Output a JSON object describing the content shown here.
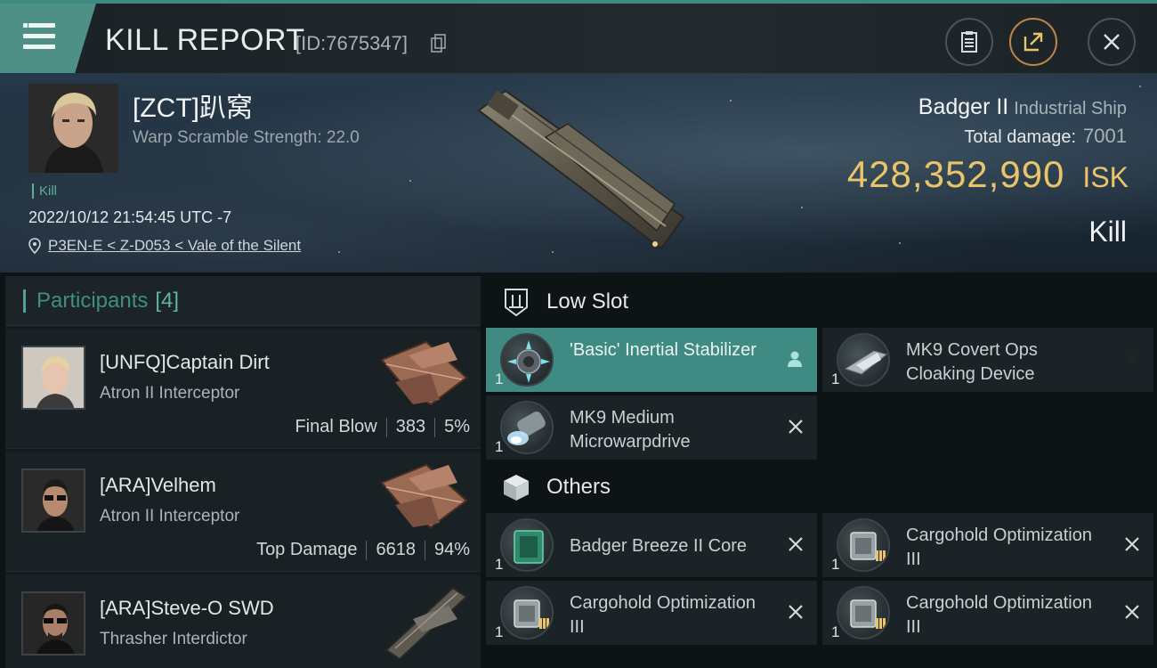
{
  "header": {
    "title": "KILL REPORT",
    "report_id": "[ID:7675347]"
  },
  "victim": {
    "name": "[ZCT]趴窝",
    "warp_scramble": "Warp Scramble Strength: 22.0",
    "tag": "Kill",
    "datetime": "2022/10/12 21:54:45 UTC -7",
    "location": "P3EN-E < Z-D053 < Vale of the Silent",
    "ship_name": "Badger II",
    "ship_class": "Industrial Ship",
    "total_damage_label": "Total damage:",
    "total_damage": "7001",
    "isk_value": "428,352,990",
    "isk_unit": "ISK",
    "result": "Kill"
  },
  "participants": {
    "label": "Participants",
    "count": "[4]",
    "rows": [
      {
        "name": "[UNFQ]Captain Dirt",
        "ship": "Atron II Interceptor",
        "role": "Final Blow",
        "damage": "383",
        "percent": "5%"
      },
      {
        "name": "[ARA]Velhem",
        "ship": "Atron II Interceptor",
        "role": "Top Damage",
        "damage": "6618",
        "percent": "94%"
      },
      {
        "name": "[ARA]Steve-O SWD",
        "ship": "Thrasher Interdictor"
      }
    ]
  },
  "sections": {
    "low_slot": "Low Slot",
    "others": "Others"
  },
  "modules": {
    "low": [
      {
        "name": "'Basic' Inertial Stabilizer",
        "qty": "1"
      },
      {
        "name": "MK9 Covert Ops Cloaking Device",
        "qty": "1"
      },
      {
        "name": "MK9 Medium Microwarpdrive",
        "qty": "1"
      }
    ],
    "others": [
      {
        "name": "Badger Breeze II Core",
        "qty": "1"
      },
      {
        "name": "Cargohold Optimization III",
        "qty": "1"
      },
      {
        "name": "Cargohold Optimization III",
        "qty": "1"
      },
      {
        "name": "Cargohold Optimization III",
        "qty": "1"
      }
    ]
  },
  "colors": {
    "accent": "#3f8a82",
    "isk": "#e9c46a"
  }
}
